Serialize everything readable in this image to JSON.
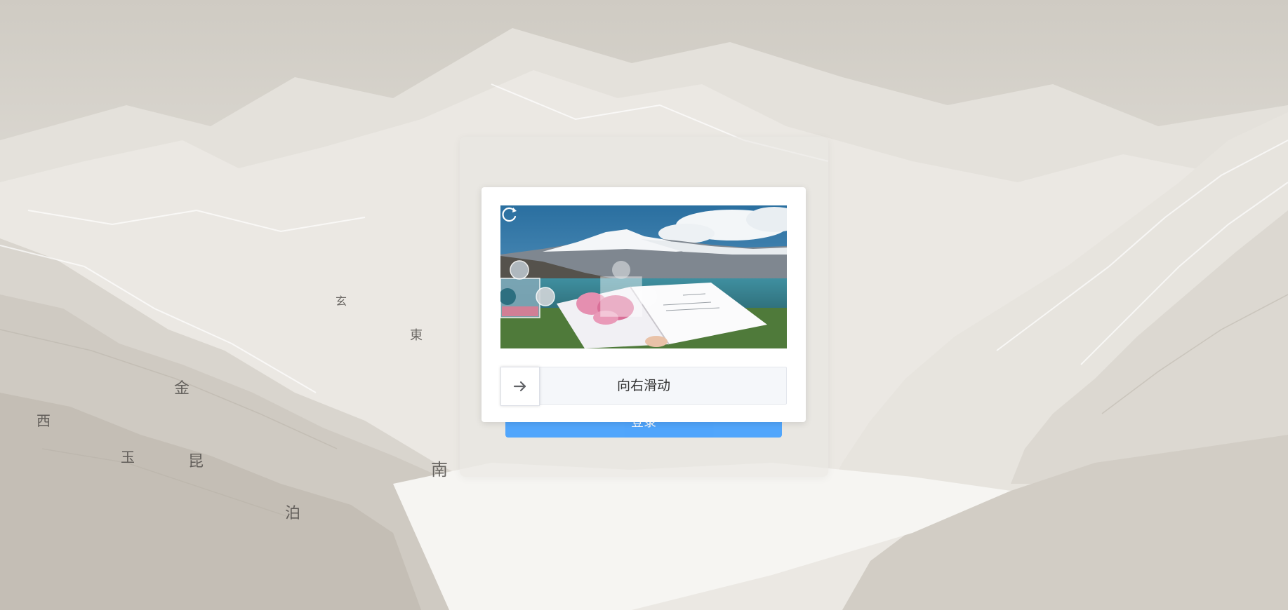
{
  "login": {
    "button_label": "登录"
  },
  "captcha": {
    "slider_hint": "向右滑动",
    "icons": {
      "refresh": "refresh-icon",
      "handle": "arrow-right-icon"
    }
  },
  "background": {
    "map_labels": [
      "玄",
      "東",
      "金",
      "西",
      "玉",
      "昆",
      "南",
      "泊"
    ]
  },
  "colors": {
    "primary": "#409eff",
    "track_bg": "#f5f7fa"
  }
}
